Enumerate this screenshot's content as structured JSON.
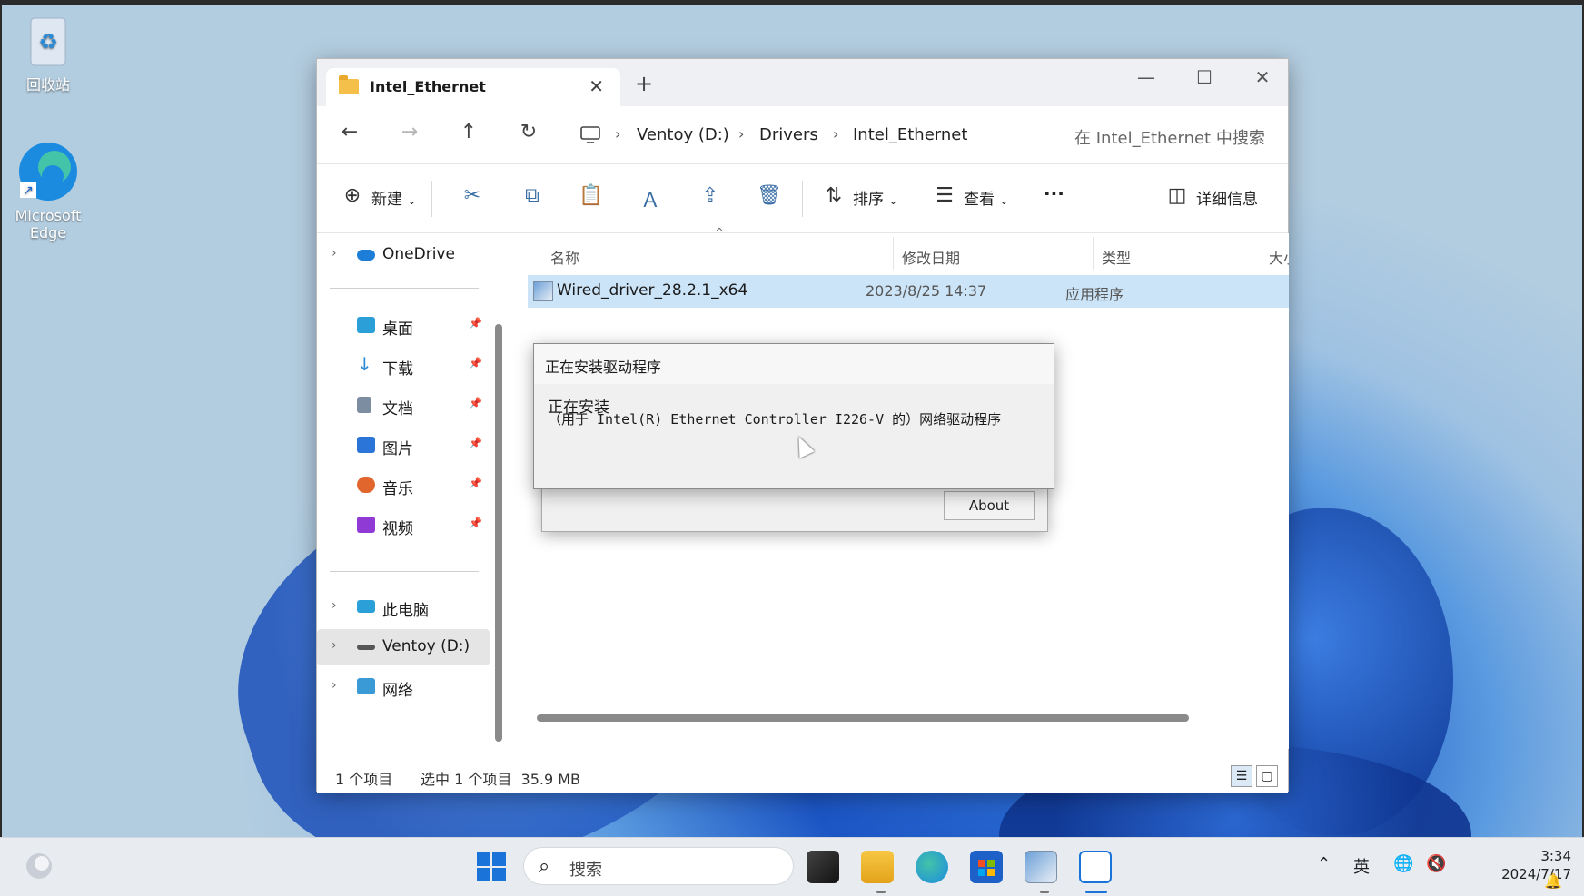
{
  "desktop": {
    "icons": [
      {
        "label": "回收站"
      },
      {
        "label": "Microsoft Edge"
      }
    ]
  },
  "explorer": {
    "tab_title": "Intel_Ethernet",
    "tab_close": "✕",
    "new_tab": "+",
    "window_controls": {
      "minimize": "—",
      "maximize": "☐",
      "close": "✕"
    },
    "nav": {
      "back": "←",
      "forward": "→",
      "up": "↑",
      "refresh": "↻"
    },
    "breadcrumb": [
      "Ventoy (D:)",
      "Drivers",
      "Intel_Ethernet"
    ],
    "breadcrumb_sep": "›",
    "search_placeholder": "在 Intel_Ethernet 中搜索",
    "toolbar": {
      "new_label": "新建",
      "sort_label": "排序",
      "view_label": "查看",
      "more_label": "···",
      "details_label": "详细信息",
      "dropdown": "⌄"
    },
    "sidebar": {
      "onedrive": "OneDrive",
      "quick": [
        {
          "label": "桌面",
          "color": "#2ba0d8"
        },
        {
          "label": "下载",
          "color": "#2a8ad6"
        },
        {
          "label": "文档",
          "color": "#7d8da1"
        },
        {
          "label": "图片",
          "color": "#2b74d8"
        },
        {
          "label": "音乐",
          "color": "#e0662d"
        },
        {
          "label": "视频",
          "color": "#8f3ad4"
        }
      ],
      "this_pc": "此电脑",
      "ventoy": "Ventoy (D:)",
      "network": "网络",
      "pin": "📌",
      "chevron": "›"
    },
    "columns": {
      "name": "名称",
      "date": "修改日期",
      "type": "类型",
      "size": "大小"
    },
    "sort_arrow": "^",
    "file": {
      "name": "Wired_driver_28.2.1_x64",
      "date": "2023/8/25 14:37",
      "type": "应用程序"
    },
    "status": {
      "count": "1 个项目",
      "selected": "选中 1 个项目  35.9 MB"
    }
  },
  "installer": {
    "title": "正在安装驱动程序",
    "line1": "正在安装",
    "line2": "（用于 Intel(R) Ethernet Controller I226-V 的）网络驱动程序",
    "about_button": "About"
  },
  "taskbar": {
    "search_placeholder": "搜索",
    "ime": "英",
    "time": "3:34",
    "date": "2024/7/17"
  }
}
